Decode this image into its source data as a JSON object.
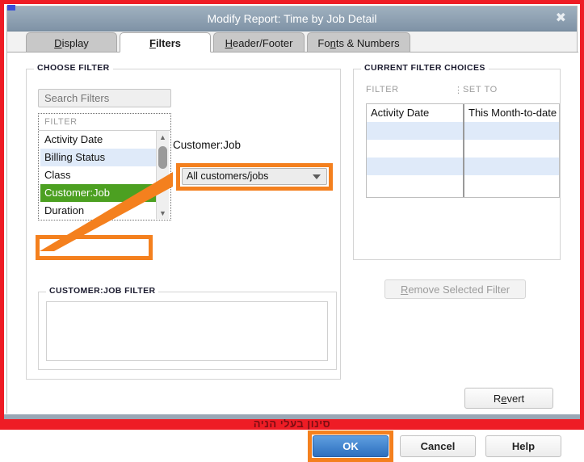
{
  "window": {
    "title": "Modify Report: Time by Job Detail",
    "close_label": "✖"
  },
  "tabs": [
    {
      "id": "display",
      "label": "Display",
      "accel": "D",
      "active": false
    },
    {
      "id": "filters",
      "label": "Filters",
      "accel": "F",
      "active": true
    },
    {
      "id": "header_footer",
      "label": "Header/Footer",
      "accel": "H",
      "active": false
    },
    {
      "id": "fonts_numbers",
      "label": "Fonts & Numbers",
      "accel": "n",
      "active": false
    }
  ],
  "choose_filter": {
    "legend": "CHOOSE FILTER",
    "search": {
      "placeholder": "Search Filters",
      "value": ""
    },
    "list_header": "FILTER",
    "items": [
      {
        "label": "Activity Date",
        "selected": false
      },
      {
        "label": "Billing Status",
        "selected": false
      },
      {
        "label": "Class",
        "selected": false
      },
      {
        "label": "Customer:Job",
        "selected": true
      },
      {
        "label": "Duration",
        "selected": false
      },
      {
        "label": "",
        "selected": false
      }
    ],
    "scroll_up_icon": "▲",
    "scroll_down_icon": "▼",
    "detail_label": "Customer:Job",
    "dropdown": {
      "value": "All customers/jobs",
      "caret_icon": "chevron-down-icon"
    }
  },
  "customer_job_filter": {
    "legend": "CUSTOMER:JOB FILTER",
    "items": []
  },
  "current_filter_choices": {
    "legend": "CURRENT FILTER CHOICES",
    "columns": [
      "FILTER",
      "SET TO"
    ],
    "rows": [
      {
        "filter": "Activity Date",
        "set_to": "This Month-to-date"
      },
      {
        "filter": "",
        "set_to": ""
      },
      {
        "filter": "",
        "set_to": ""
      },
      {
        "filter": "",
        "set_to": ""
      },
      {
        "filter": "",
        "set_to": ""
      }
    ],
    "remove_button": "Remove Selected Filter",
    "remove_button_accel": "R",
    "remove_button_enabled": false
  },
  "revert_button": {
    "label": "Revert",
    "accel": "e"
  },
  "footer": {
    "ok": "OK",
    "cancel": "Cancel",
    "help": "Help"
  },
  "annotations": {
    "highlight_color": "#f4801e",
    "frame_color": "#ee1c25",
    "selected_row_color": "#4ca021",
    "ok_button_color": "#2e6fbe",
    "bottom_clipped_text": "סינון בעלי הניה"
  }
}
